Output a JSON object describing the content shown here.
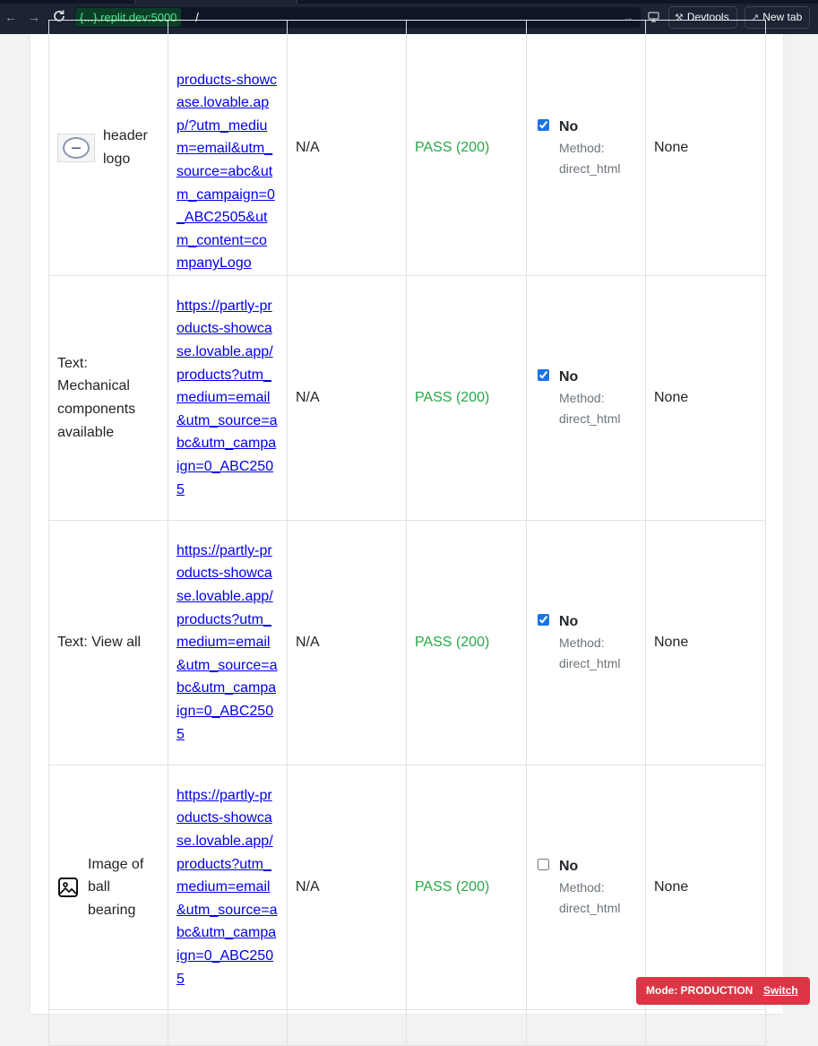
{
  "browser": {
    "url_host": "{...}.replit.dev:5000",
    "url_path": "/",
    "devtools_label": "Devtools",
    "new_tab_label": "New tab"
  },
  "rows": [
    {
      "element": "header logo",
      "element_type": "logo-image",
      "url": "products-showcase.lovable.app/?utm_medium=email&utm_source=abc&utm_campaign=0_ABC2505&utm_content=companyLogo",
      "col3": "N/A",
      "status": "PASS (200)",
      "tracked_checked": true,
      "tracked_label": "No",
      "method": "Method: direct_html",
      "issues": "None"
    },
    {
      "element": "Text: Mechanical components available",
      "element_type": "text",
      "url": "https://partly-products-showcase.lovable.app/products?utm_medium=email&utm_source=abc&utm_campaign=0_ABC2505",
      "col3": "N/A",
      "status": "PASS (200)",
      "tracked_checked": true,
      "tracked_label": "No",
      "method": "Method: direct_html",
      "issues": "None"
    },
    {
      "element": "Text: View all",
      "element_type": "text",
      "url": "https://partly-products-showcase.lovable.app/products?utm_medium=email&utm_source=abc&utm_campaign=0_ABC2505",
      "col3": "N/A",
      "status": "PASS (200)",
      "tracked_checked": true,
      "tracked_label": "No",
      "method": "Method: direct_html",
      "issues": "None"
    },
    {
      "element": "Image of ball bearing",
      "element_type": "image",
      "url": "https://partly-products-showcase.lovable.app/products?utm_medium=email&utm_source=abc&utm_campaign=0_ABC2505",
      "col3": "N/A",
      "status": "PASS (200)",
      "tracked_checked": false,
      "tracked_label": "No",
      "method": "Method: direct_html",
      "issues": "None"
    }
  ],
  "mode_badge": {
    "label": "Mode: PRODUCTION",
    "switch_label": "Switch",
    "color": "#dc3545"
  },
  "colors": {
    "pass": "#28a745",
    "link": "#0000ee",
    "accent_check": "#1a73e8"
  }
}
